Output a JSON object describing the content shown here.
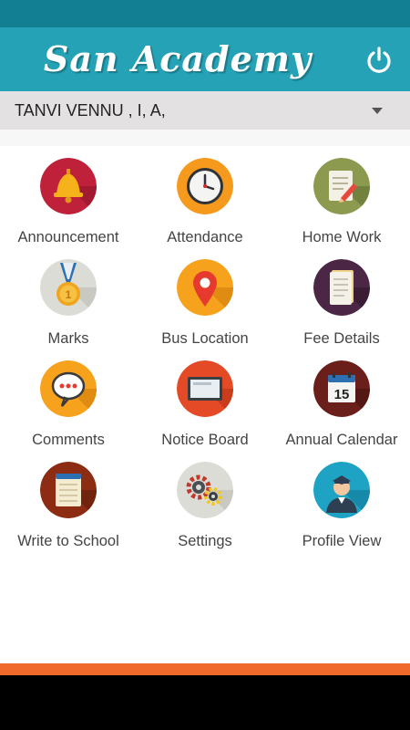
{
  "colors": {
    "status_bar": "#137f92",
    "app_bar": "#25a2b6",
    "accent_orange": "#ef6a2b",
    "student_bar": "#e3e1e1"
  },
  "header": {
    "title": "San Academy",
    "power_icon": "power-icon"
  },
  "student": {
    "selected": "TANVI VENNU ,  I, A,"
  },
  "menu": [
    {
      "label": "Announcement",
      "icon": "bell-icon"
    },
    {
      "label": "Attendance",
      "icon": "clock-icon"
    },
    {
      "label": "Home Work",
      "icon": "notepad-pencil-icon"
    },
    {
      "label": "Marks",
      "icon": "medal-icon"
    },
    {
      "label": "Bus Location",
      "icon": "map-pin-icon"
    },
    {
      "label": "Fee Details",
      "icon": "document-icon"
    },
    {
      "label": "Comments",
      "icon": "chat-bubble-icon"
    },
    {
      "label": "Notice Board",
      "icon": "tablet-icon"
    },
    {
      "label": "Annual Calendar",
      "icon": "calendar-icon",
      "calendar_day": "15"
    },
    {
      "label": "Write to School",
      "icon": "notebook-icon"
    },
    {
      "label": "Settings",
      "icon": "gears-icon"
    },
    {
      "label": "Profile View",
      "icon": "user-icon"
    }
  ]
}
